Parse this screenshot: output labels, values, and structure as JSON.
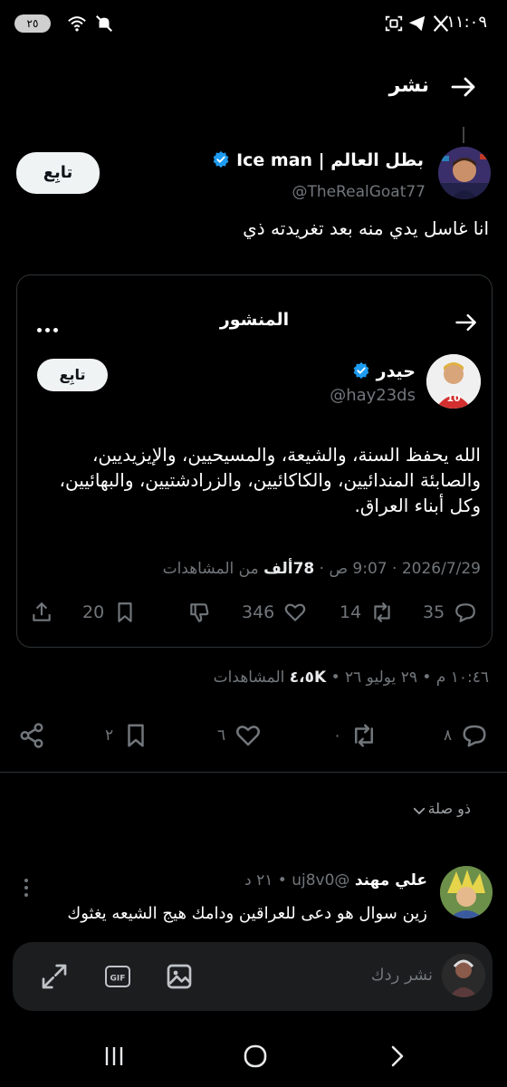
{
  "status_bar": {
    "time": "١١:٠٩",
    "battery": "٢٥"
  },
  "header": {
    "title": "نشر"
  },
  "tweet": {
    "author_name": "بطل العالم | Ice man",
    "handle": "@TheRealGoat77",
    "follow_label": "تابِع",
    "text": "انا غاسل يدي منه بعد تغريدته ذي",
    "quote": {
      "title": "المنشور",
      "author_name": "حيدر",
      "handle": "@hay23ds",
      "follow_label": "تابِع",
      "text": "الله يحفظ السنة، والشيعة، والمسيحيين، والإيزيديين، والصابئة المندائيين، والكاكائيين، والزرادشتيين، والبهائيين، وكل أبناء العراق.",
      "date": "2026/7/29 · 9:07 ص · ",
      "views_count": "78ألف",
      "views_label": " من المشاهدات",
      "replies": "35",
      "reposts": "14",
      "likes": "346",
      "bookmarks": "20"
    },
    "meta": {
      "time_date": "١٠:٤٦ م • ٢٩ يوليو ٢٦ • ",
      "views_count": "٤،٥K",
      "views_label": " المشاهدات"
    },
    "counts": {
      "replies": "٨",
      "reposts": "٠",
      "likes": "٦",
      "bookmarks": "٢"
    }
  },
  "related": {
    "label": "ذو صلة"
  },
  "reply": {
    "name": "علي مهند",
    "handle_time": " @uj8v0 • ٢١ د",
    "text": "زين سوال هو دعى للعراقين ودامك هيج الشيعه يغثوك"
  },
  "composer": {
    "placeholder": "نشر ردك"
  },
  "colors": {
    "background": "#000000",
    "text": "#e7e9ea",
    "muted": "#71767b",
    "verified": "#1d9bf0",
    "border": "#2f3336"
  }
}
